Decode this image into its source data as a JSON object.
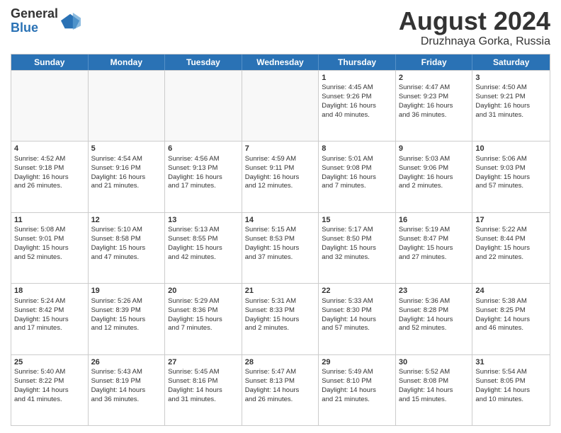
{
  "logo": {
    "general": "General",
    "blue": "Blue"
  },
  "title": "August 2024",
  "subtitle": "Druzhnaya Gorka, Russia",
  "days_of_week": [
    "Sunday",
    "Monday",
    "Tuesday",
    "Wednesday",
    "Thursday",
    "Friday",
    "Saturday"
  ],
  "weeks": [
    [
      {
        "day": "",
        "content": "",
        "empty": true
      },
      {
        "day": "",
        "content": "",
        "empty": true
      },
      {
        "day": "",
        "content": "",
        "empty": true
      },
      {
        "day": "",
        "content": "",
        "empty": true
      },
      {
        "day": "1",
        "content": "Sunrise: 4:45 AM\nSunset: 9:26 PM\nDaylight: 16 hours\nand 40 minutes."
      },
      {
        "day": "2",
        "content": "Sunrise: 4:47 AM\nSunset: 9:23 PM\nDaylight: 16 hours\nand 36 minutes."
      },
      {
        "day": "3",
        "content": "Sunrise: 4:50 AM\nSunset: 9:21 PM\nDaylight: 16 hours\nand 31 minutes."
      }
    ],
    [
      {
        "day": "4",
        "content": "Sunrise: 4:52 AM\nSunset: 9:18 PM\nDaylight: 16 hours\nand 26 minutes."
      },
      {
        "day": "5",
        "content": "Sunrise: 4:54 AM\nSunset: 9:16 PM\nDaylight: 16 hours\nand 21 minutes."
      },
      {
        "day": "6",
        "content": "Sunrise: 4:56 AM\nSunset: 9:13 PM\nDaylight: 16 hours\nand 17 minutes."
      },
      {
        "day": "7",
        "content": "Sunrise: 4:59 AM\nSunset: 9:11 PM\nDaylight: 16 hours\nand 12 minutes."
      },
      {
        "day": "8",
        "content": "Sunrise: 5:01 AM\nSunset: 9:08 PM\nDaylight: 16 hours\nand 7 minutes."
      },
      {
        "day": "9",
        "content": "Sunrise: 5:03 AM\nSunset: 9:06 PM\nDaylight: 16 hours\nand 2 minutes."
      },
      {
        "day": "10",
        "content": "Sunrise: 5:06 AM\nSunset: 9:03 PM\nDaylight: 15 hours\nand 57 minutes."
      }
    ],
    [
      {
        "day": "11",
        "content": "Sunrise: 5:08 AM\nSunset: 9:01 PM\nDaylight: 15 hours\nand 52 minutes."
      },
      {
        "day": "12",
        "content": "Sunrise: 5:10 AM\nSunset: 8:58 PM\nDaylight: 15 hours\nand 47 minutes."
      },
      {
        "day": "13",
        "content": "Sunrise: 5:13 AM\nSunset: 8:55 PM\nDaylight: 15 hours\nand 42 minutes."
      },
      {
        "day": "14",
        "content": "Sunrise: 5:15 AM\nSunset: 8:53 PM\nDaylight: 15 hours\nand 37 minutes."
      },
      {
        "day": "15",
        "content": "Sunrise: 5:17 AM\nSunset: 8:50 PM\nDaylight: 15 hours\nand 32 minutes."
      },
      {
        "day": "16",
        "content": "Sunrise: 5:19 AM\nSunset: 8:47 PM\nDaylight: 15 hours\nand 27 minutes."
      },
      {
        "day": "17",
        "content": "Sunrise: 5:22 AM\nSunset: 8:44 PM\nDaylight: 15 hours\nand 22 minutes."
      }
    ],
    [
      {
        "day": "18",
        "content": "Sunrise: 5:24 AM\nSunset: 8:42 PM\nDaylight: 15 hours\nand 17 minutes."
      },
      {
        "day": "19",
        "content": "Sunrise: 5:26 AM\nSunset: 8:39 PM\nDaylight: 15 hours\nand 12 minutes."
      },
      {
        "day": "20",
        "content": "Sunrise: 5:29 AM\nSunset: 8:36 PM\nDaylight: 15 hours\nand 7 minutes."
      },
      {
        "day": "21",
        "content": "Sunrise: 5:31 AM\nSunset: 8:33 PM\nDaylight: 15 hours\nand 2 minutes."
      },
      {
        "day": "22",
        "content": "Sunrise: 5:33 AM\nSunset: 8:30 PM\nDaylight: 14 hours\nand 57 minutes."
      },
      {
        "day": "23",
        "content": "Sunrise: 5:36 AM\nSunset: 8:28 PM\nDaylight: 14 hours\nand 52 minutes."
      },
      {
        "day": "24",
        "content": "Sunrise: 5:38 AM\nSunset: 8:25 PM\nDaylight: 14 hours\nand 46 minutes."
      }
    ],
    [
      {
        "day": "25",
        "content": "Sunrise: 5:40 AM\nSunset: 8:22 PM\nDaylight: 14 hours\nand 41 minutes."
      },
      {
        "day": "26",
        "content": "Sunrise: 5:43 AM\nSunset: 8:19 PM\nDaylight: 14 hours\nand 36 minutes."
      },
      {
        "day": "27",
        "content": "Sunrise: 5:45 AM\nSunset: 8:16 PM\nDaylight: 14 hours\nand 31 minutes."
      },
      {
        "day": "28",
        "content": "Sunrise: 5:47 AM\nSunset: 8:13 PM\nDaylight: 14 hours\nand 26 minutes."
      },
      {
        "day": "29",
        "content": "Sunrise: 5:49 AM\nSunset: 8:10 PM\nDaylight: 14 hours\nand 21 minutes."
      },
      {
        "day": "30",
        "content": "Sunrise: 5:52 AM\nSunset: 8:08 PM\nDaylight: 14 hours\nand 15 minutes."
      },
      {
        "day": "31",
        "content": "Sunrise: 5:54 AM\nSunset: 8:05 PM\nDaylight: 14 hours\nand 10 minutes."
      }
    ]
  ]
}
